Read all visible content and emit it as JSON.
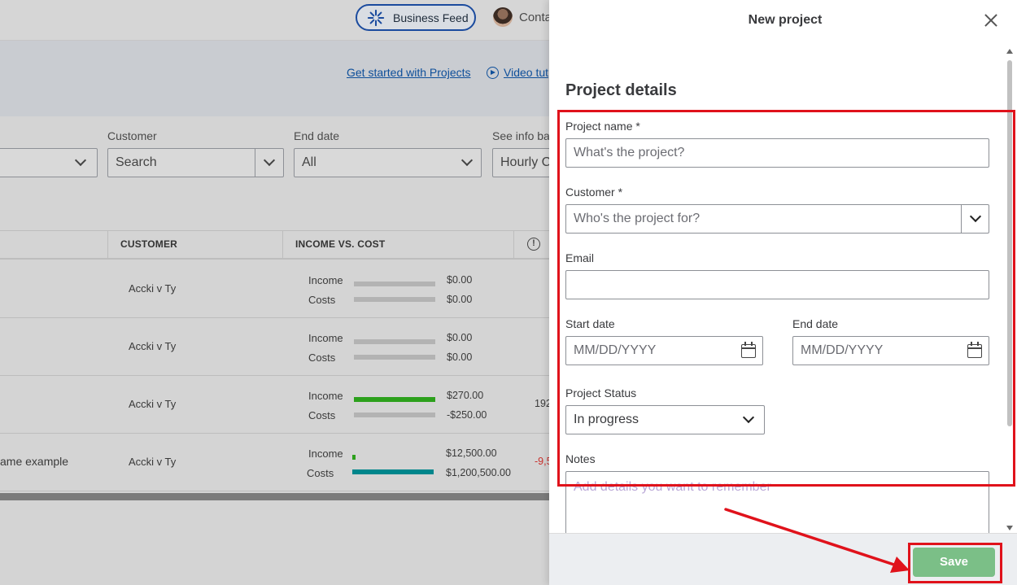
{
  "topbar": {
    "business_feed_label": "Business Feed",
    "contact_label": "Conta"
  },
  "banner": {
    "get_started_link": "Get started with Projects",
    "video_link": "Video tut"
  },
  "filters": {
    "customer_label": "Customer",
    "customer_placeholder": "Search",
    "end_date_label": "End date",
    "end_date_value": "All",
    "see_info_label": "See info ba",
    "see_info_value": "Hourly C"
  },
  "table": {
    "headers": [
      "CUSTOMER",
      "INCOME VS. COST"
    ],
    "rows": [
      {
        "name": "",
        "customer": "Accki v Ty",
        "income_label": "Income",
        "costs_label": "Costs",
        "income": "$0.00",
        "costs": "$0.00",
        "extra": ""
      },
      {
        "name": "",
        "customer": "Accki v Ty",
        "income_label": "Income",
        "costs_label": "Costs",
        "income": "$0.00",
        "costs": "$0.00",
        "extra": ""
      },
      {
        "name": "",
        "customer": "Accki v Ty",
        "income_label": "Income",
        "costs_label": "Costs",
        "income": "$270.00",
        "costs": "-$250.00",
        "extra": "192"
      },
      {
        "name": "ame example",
        "customer": "Accki v Ty",
        "income_label": "Income",
        "costs_label": "Costs",
        "income": "$12,500.00",
        "costs": "$1,200,500.00",
        "extra": "-9,5"
      }
    ]
  },
  "panel": {
    "title": "New project",
    "section_title": "Project details",
    "project_name_label": "Project name *",
    "project_name_placeholder": "What's the project?",
    "customer_label": "Customer *",
    "customer_placeholder": "Who's the project for?",
    "email_label": "Email",
    "start_date_label": "Start date",
    "start_date_placeholder": "MM/DD/YYYY",
    "end_date_label": "End date",
    "end_date_placeholder": "MM/DD/YYYY",
    "status_label": "Project Status",
    "status_value": "In progress",
    "notes_label": "Notes",
    "notes_placeholder": "Add details you want to remember",
    "save_label": "Save"
  },
  "colors": {
    "annotation": "#e0121b",
    "save_button": "#7bbf87",
    "income_bar_green": "#2ca01c",
    "costs_bar_teal": "#00868c",
    "link": "#0e4f9a"
  }
}
